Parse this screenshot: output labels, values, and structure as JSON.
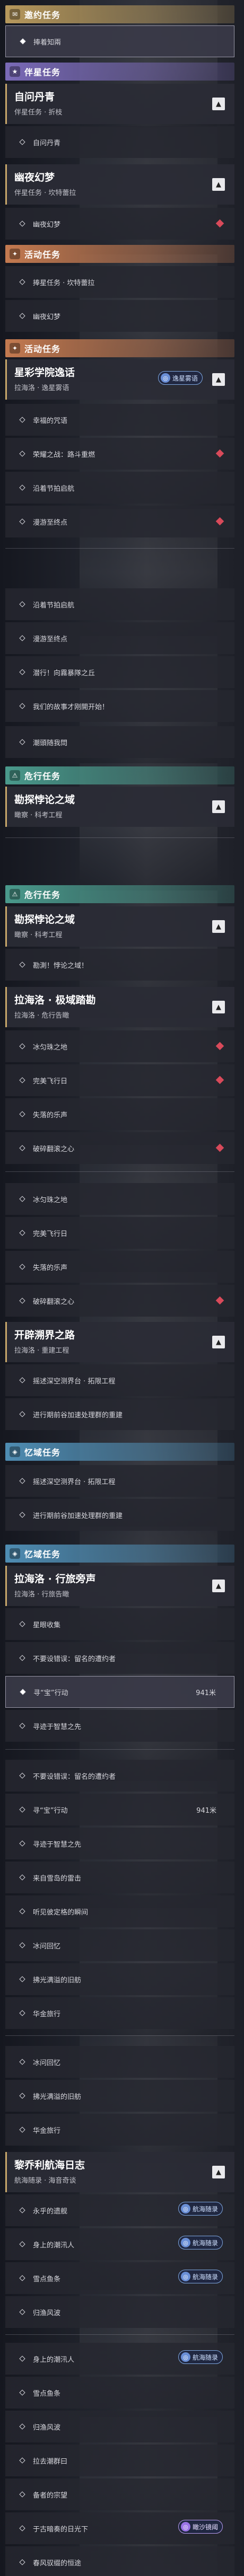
{
  "colors": {
    "gold": "#b7995d",
    "purple": "#7b6bb8",
    "orange": "#c47a50",
    "teal": "#4a9a8c",
    "blue": "#4f8db3",
    "alert": "#d84a5a"
  },
  "sections": [
    {
      "label": "邀约任务",
      "icon": "invite-icon",
      "color": "gold"
    },
    {
      "label": "伴星任务",
      "icon": "companion-icon",
      "color": "purple"
    },
    {
      "label": "活动任务",
      "icon": "event-icon",
      "color": "orange"
    },
    {
      "label": "活动任务",
      "icon": "event-icon",
      "color": "orange"
    },
    {
      "label": "危行任务",
      "icon": "danger-icon",
      "color": "teal"
    },
    {
      "label": "危行任务",
      "icon": "danger-icon",
      "color": "teal"
    },
    {
      "label": "忆域任务",
      "icon": "memory-icon",
      "color": "blue"
    },
    {
      "label": "忆域任务",
      "icon": "memory-icon",
      "color": "blue"
    }
  ],
  "groups": [
    {
      "title": "自问丹青",
      "sub": "伴星任务 · 折枝"
    },
    {
      "title": "幽夜幻梦",
      "sub": "伴星任务 · 坎特蕾拉"
    },
    {
      "title": "星彩学院逸话",
      "sub": "拉海洛 · 逸星雾语"
    },
    {
      "title": "勘探悖论之域",
      "sub": "瞰察 · 科考工程"
    },
    {
      "title": "勘探悖论之域",
      "sub": "瞰察 · 科考工程"
    },
    {
      "title": "拉海洛 · 极域踏勘",
      "sub": "拉海洛 · 危行告瞰"
    },
    {
      "title": "开辟溯界之路",
      "sub": "拉海洛 · 重建工程"
    },
    {
      "title": "拉海洛 · 行旅旁声",
      "sub": "拉海洛 · 行旅告瞰"
    },
    {
      "title": "黎乔利航海日志",
      "sub": "航海随录 · 海音奇谈"
    }
  ],
  "items": [
    "捧着知兩",
    "自问丹青",
    "幽夜幻梦",
    "捧星任务 · 坎特蕾拉",
    "幽夜幻梦",
    "幸福的咒语",
    "荣耀之战：路斗重燃",
    "沿着节拍启航",
    "漫游至终点",
    "沿着节拍启航",
    "漫游至终点",
    "潜行！向霧暴隊之丘",
    "我们的故事才刚開开始！",
    "潮頭随我問",
    "勘測！悖论之域！",
    "冰匀珠之地",
    "完美飞行日",
    "失落的乐声",
    "冰匀珠之地",
    "完美飞行日",
    "失落的乐声",
    "破碎翻滚之心",
    "摇述深空测界台 · 拓限工程",
    "进行期前谷加速处理群的重建",
    "摇述深空测界台 · 拓限工程",
    "进行期前谷加速处理群的重建",
    "星眼收集",
    "不要设错误：留名的遭约者",
    "寻“宝”行动",
    "寻迹于智慧之先",
    "不要设错误：留名的遭约者",
    "寻“宝”行动",
    "寻迹于智慧之先",
    "来自雪岛的雷击",
    "听见彼定格的瞬间",
    "冰问回忆",
    "拂光满溢的旧舫",
    "华金旅行",
    "冰问回忆",
    "拂光满溢的旧舫",
    "华金旅行",
    "永乎的遗舰",
    "身上的潮汛人",
    "雪点鱼条",
    "归渔风波",
    "身上的潮汛人",
    "雪点鱼条",
    "归渔风波",
    "拉去潮群曰",
    "备者的宗望",
    "于古暗奏的日光下",
    "春风驭缀的恒途",
    "如想都奔赞顶峰"
  ],
  "counts": {
    "a": "941米",
    "b": "941米"
  },
  "badges": {
    "star": "逸星雾语",
    "voyage": "航海随录",
    "watch": "瞰沙镜阈"
  }
}
